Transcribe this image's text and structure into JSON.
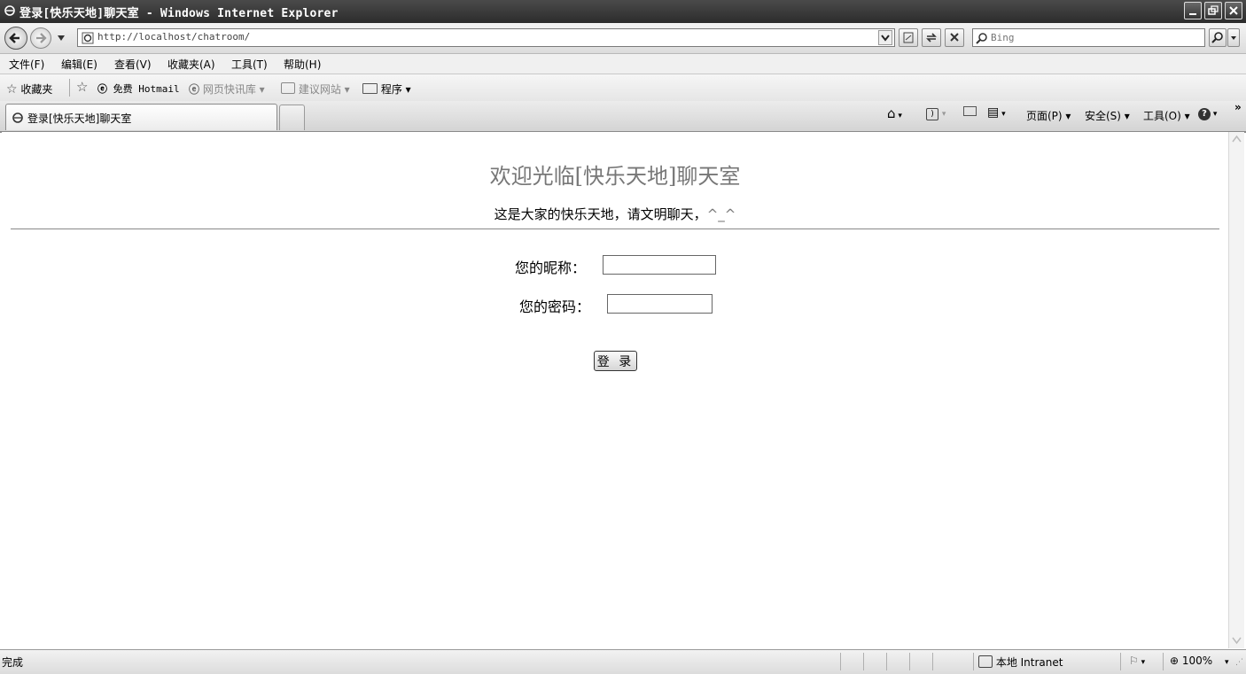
{
  "window": {
    "title": "登录[快乐天地]聊天室 - Windows Internet Explorer"
  },
  "address_bar": {
    "url": "http://localhost/chatroom/"
  },
  "search": {
    "placeholder": "Bing"
  },
  "menu": {
    "items": [
      "文件(F)",
      "编辑(E)",
      "查看(V)",
      "收藏夹(A)",
      "工具(T)",
      "帮助(H)"
    ]
  },
  "favorites_bar": {
    "favorites_label": "收藏夹",
    "hotmail": "免费 Hotmail",
    "web_slice": "网页快讯库 ▾",
    "suggested_sites": "建议网站 ▾",
    "programs": "程序 ▾"
  },
  "tabs": {
    "active_label": "登录[快乐天地]聊天室"
  },
  "command_bar": {
    "page": "页面(P) ▾",
    "safety": "安全(S) ▾",
    "tools": "工具(O) ▾"
  },
  "page": {
    "heading": "欢迎光临[快乐天地]聊天室",
    "subtitle_text": "这是大家的快乐天地，请文明聊天，",
    "subtitle_emote": "^_^",
    "nickname_label": "您的昵称：",
    "password_label": "您的密码：",
    "login_button": "登 录"
  },
  "status_bar": {
    "status": "完成",
    "zone": "本地 Intranet",
    "zoom": "100%"
  }
}
